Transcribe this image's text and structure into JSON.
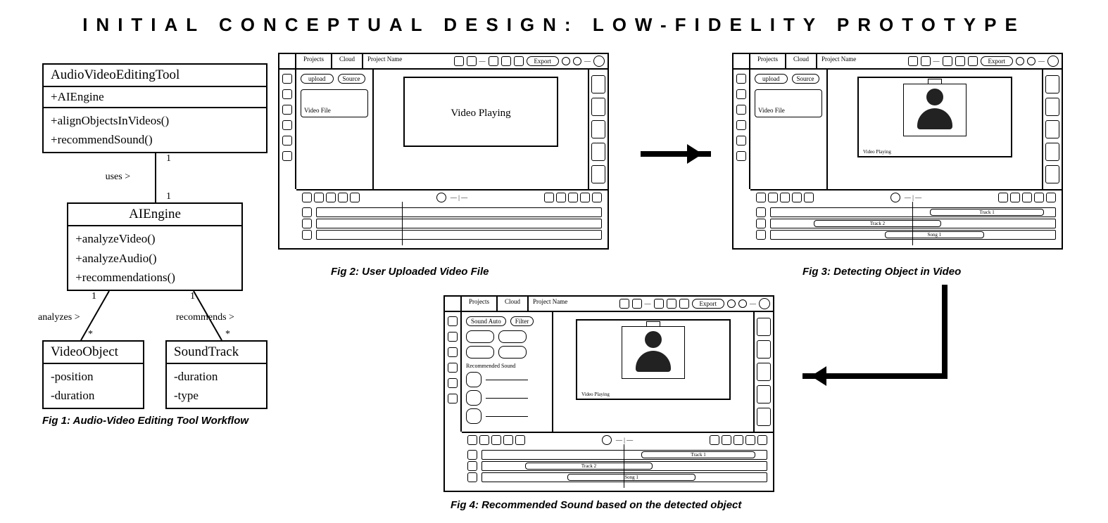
{
  "title": "INITIAL CONCEPTUAL DESIGN: LOW-FIDELITY PROTOTYPE",
  "captions": {
    "fig1": "Fig 1: Audio-Video Editing Tool Workflow",
    "fig2": "Fig 2: User Uploaded Video File",
    "fig3": "Fig 3: Detecting Object in Video",
    "fig4": "Fig 4: Recommended Sound based on the detected object"
  },
  "uml": {
    "top": {
      "name": "AudioVideoEditingTool",
      "attrs": "+AIEngine",
      "ops": [
        "+alignObjectsInVideos()",
        "+recommendSound()"
      ]
    },
    "rel_top": {
      "mult_a": "1",
      "label": "uses >",
      "mult_b": "1"
    },
    "mid": {
      "name": "AIEngine",
      "ops": [
        "+analyzeVideo()",
        "+analyzeAudio()",
        "+recommendations()"
      ]
    },
    "rel_left": {
      "mult_a": "1",
      "label": "analyzes >",
      "mult_b": "*"
    },
    "rel_right": {
      "mult_a": "1",
      "label": "recommends >",
      "mult_b": "*"
    },
    "left": {
      "name": "VideoObject",
      "ops": [
        "-position",
        "-duration"
      ]
    },
    "right": {
      "name": "SoundTrack",
      "ops": [
        "-duration",
        "-type"
      ]
    }
  },
  "mock": {
    "tabs": {
      "projects": "Projects",
      "cloud": "Cloud"
    },
    "project_name": "Project Name",
    "export": "Export",
    "upload": "upload",
    "source": "Source",
    "video_file": "Video File",
    "video_playing": "Video Playing",
    "video_playing_small": "Video Playing",
    "track1": "Track 1",
    "track2": "Track 2",
    "song1": "Song 1",
    "sound_auto": "Sound Auto",
    "filter": "Filter",
    "recommended_sound": "Recommended Sound"
  }
}
